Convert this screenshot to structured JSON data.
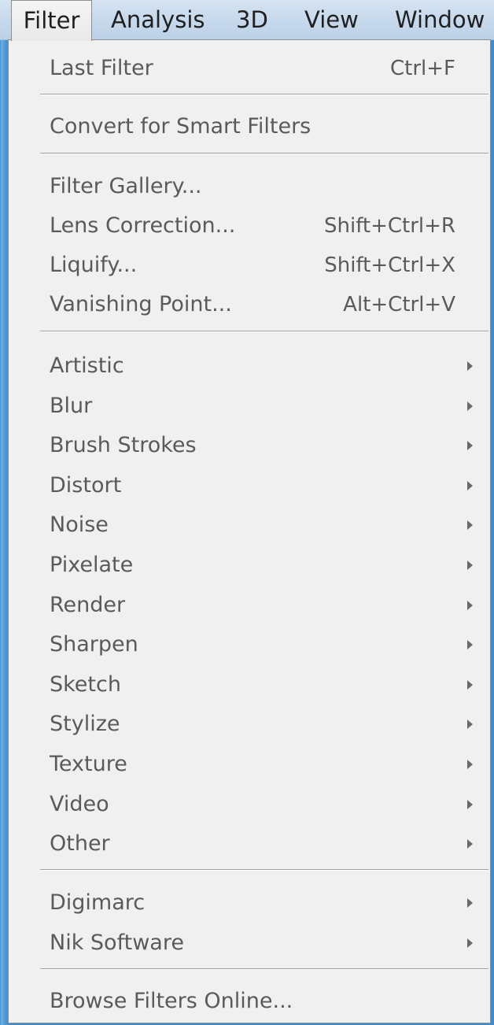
{
  "menubar": {
    "items": [
      {
        "label": "Filter",
        "active": true
      },
      {
        "label": "Analysis"
      },
      {
        "label": "3D"
      },
      {
        "label": "View"
      },
      {
        "label": "Window"
      }
    ]
  },
  "menu": {
    "items": [
      {
        "label": "Last Filter",
        "shortcut": "Ctrl+F"
      },
      {
        "label": "Convert for Smart Filters"
      },
      {
        "label": "Filter Gallery..."
      },
      {
        "label": "Lens Correction...",
        "shortcut": "Shift+Ctrl+R"
      },
      {
        "label": "Liquify...",
        "shortcut": "Shift+Ctrl+X"
      },
      {
        "label": "Vanishing Point...",
        "shortcut": "Alt+Ctrl+V"
      },
      {
        "label": "Artistic",
        "submenu": true
      },
      {
        "label": "Blur",
        "submenu": true
      },
      {
        "label": "Brush Strokes",
        "submenu": true
      },
      {
        "label": "Distort",
        "submenu": true
      },
      {
        "label": "Noise",
        "submenu": true
      },
      {
        "label": "Pixelate",
        "submenu": true
      },
      {
        "label": "Render",
        "submenu": true
      },
      {
        "label": "Sharpen",
        "submenu": true
      },
      {
        "label": "Sketch",
        "submenu": true
      },
      {
        "label": "Stylize",
        "submenu": true
      },
      {
        "label": "Texture",
        "submenu": true
      },
      {
        "label": "Video",
        "submenu": true
      },
      {
        "label": "Other",
        "submenu": true
      },
      {
        "label": "Digimarc",
        "submenu": true
      },
      {
        "label": "Nik Software",
        "submenu": true
      },
      {
        "label": "Browse Filters Online..."
      }
    ]
  },
  "colors": {
    "menu_background": "#f0f0f0",
    "menu_text": "#5a5a5a",
    "menubar_background": "#c7d9ec"
  }
}
